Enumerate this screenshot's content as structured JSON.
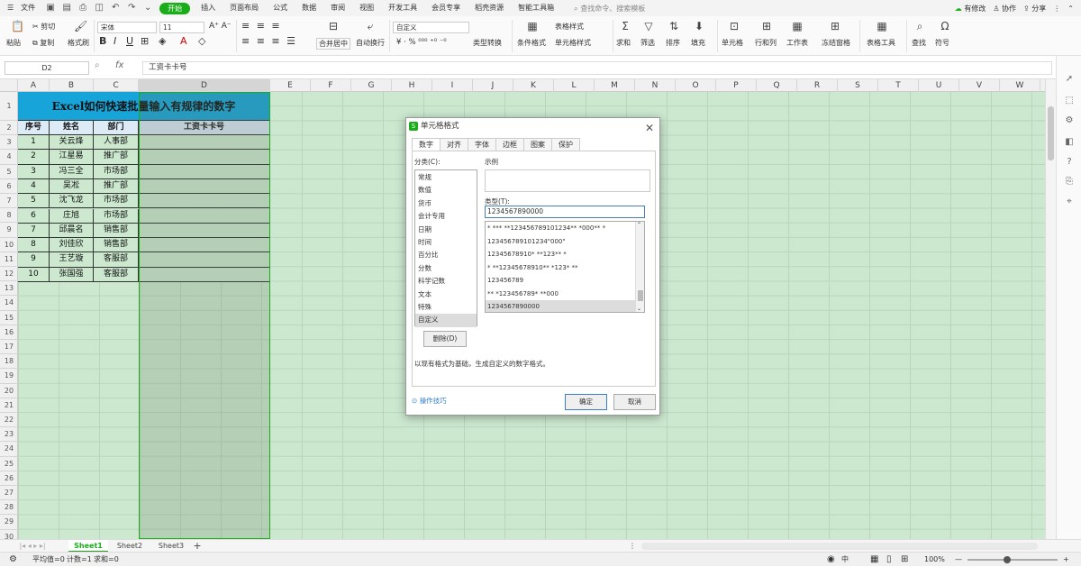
{
  "menubar": {
    "file": "文件",
    "items": [
      "开始",
      "插入",
      "页面布局",
      "公式",
      "数据",
      "审阅",
      "视图",
      "开发工具",
      "会员专享",
      "稻壳资源",
      "智能工具箱"
    ],
    "search": "查找命令、搜索模板",
    "edit": "有修改",
    "collab": "协作",
    "share": "分享"
  },
  "ribbon": {
    "paste": "粘贴",
    "cut": "剪切",
    "copy": "复制",
    "format_painter": "格式刷",
    "font": "宋体",
    "font_size": "11",
    "merge": "合并居中",
    "wrap": "自动换行",
    "numfmt": "自定义",
    "type_convert": "类型转换",
    "cond_format": "条件格式",
    "table_style": "表格样式",
    "cell_style": "单元格样式",
    "sum": "求和",
    "filter": "筛选",
    "sort": "排序",
    "fill": "填充",
    "cell": "单元格",
    "rowcol": "行和列",
    "sheet": "工作表",
    "freeze": "冻结窗格",
    "table_tools": "表格工具",
    "find": "查找",
    "symbol": "符号"
  },
  "formula": {
    "name_box": "D2",
    "fx": "fx",
    "value": "工资卡卡号"
  },
  "columns": [
    "A",
    "B",
    "C",
    "D",
    "E",
    "F",
    "G",
    "H",
    "I",
    "J",
    "K",
    "L",
    "M",
    "N",
    "O",
    "P",
    "Q",
    "R",
    "S",
    "T",
    "U",
    "V",
    "W"
  ],
  "sheet": {
    "title": "Excel如何快速批量输入有规律的数字",
    "headers": [
      "序号",
      "姓名",
      "部门",
      "工资卡卡号"
    ],
    "rows": [
      [
        "1",
        "关云烽",
        "人事部"
      ],
      [
        "2",
        "江星易",
        "推广部"
      ],
      [
        "3",
        "冯三全",
        "市场部"
      ],
      [
        "4",
        "吴凇",
        "推广部"
      ],
      [
        "5",
        "沈飞龙",
        "市场部"
      ],
      [
        "6",
        "庄旭",
        "市场部"
      ],
      [
        "7",
        "邱晨名",
        "销售部"
      ],
      [
        "8",
        "刘佳欣",
        "销售部"
      ],
      [
        "9",
        "王艺璇",
        "客服部"
      ],
      [
        "10",
        "张国强",
        "客服部"
      ]
    ]
  },
  "dialog": {
    "title": "单元格格式",
    "tabs": [
      "数字",
      "对齐",
      "字体",
      "边框",
      "图案",
      "保护"
    ],
    "category_label": "分类(C):",
    "categories": [
      "常规",
      "数值",
      "货币",
      "会计专用",
      "日期",
      "时间",
      "百分比",
      "分数",
      "科学记数",
      "文本",
      "特殊",
      "自定义"
    ],
    "sample_label": "示例",
    "type_label": "类型(T):",
    "type_value": "1234567890000",
    "type_list": [
      "* *** **123456789101234** *000** *",
      "123456789101234\"000\"",
      "12345678910* **123** *",
      "* **12345678910** *123* **",
      "123456789",
      "** *123456789* **000",
      "1234567890000"
    ],
    "delete": "删除(D)",
    "hint": "以现有格式为基础，生成自定义的数字格式。",
    "tip": "操作技巧",
    "ok": "确定",
    "cancel": "取消"
  },
  "sheets": {
    "tabs": [
      "Sheet1",
      "Sheet2",
      "Sheet3"
    ]
  },
  "status": {
    "avg": "平均值=0",
    "count": "计数=1",
    "sum": "求和=0",
    "zoom": "100%"
  }
}
